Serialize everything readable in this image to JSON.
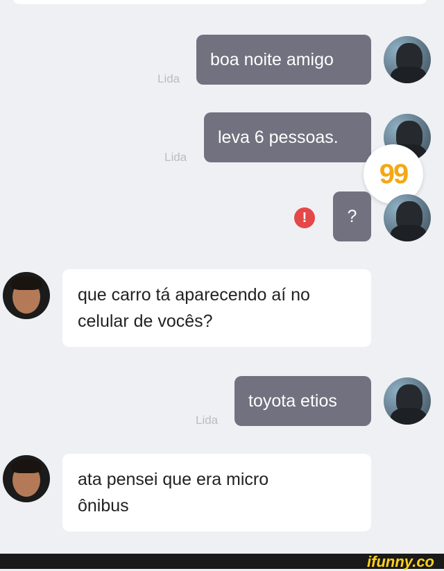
{
  "messages": [
    {
      "text": "boa noite amigo",
      "read": "Lida"
    },
    {
      "text": "leva 6 pessoas.",
      "read": "Lida"
    },
    {
      "text": "?"
    },
    {
      "text_lines": [
        "que carro tá aparecendo aí no",
        "celular de vocês?"
      ]
    },
    {
      "text": "toyota etios",
      "read": "Lida"
    },
    {
      "text_lines": [
        "ata pensei que era micro",
        "ônibus"
      ]
    }
  ],
  "badge": {
    "text": "99",
    "color": "#f4a814"
  },
  "error_icon": {
    "glyph": "!",
    "color": "#e54848"
  },
  "watermark": {
    "text": "ifunny.co",
    "color": "#ffd11a"
  },
  "colors": {
    "outgoing_bubble": "#71717f",
    "incoming_bubble": "#ffffff",
    "background": "#eef0f4"
  }
}
